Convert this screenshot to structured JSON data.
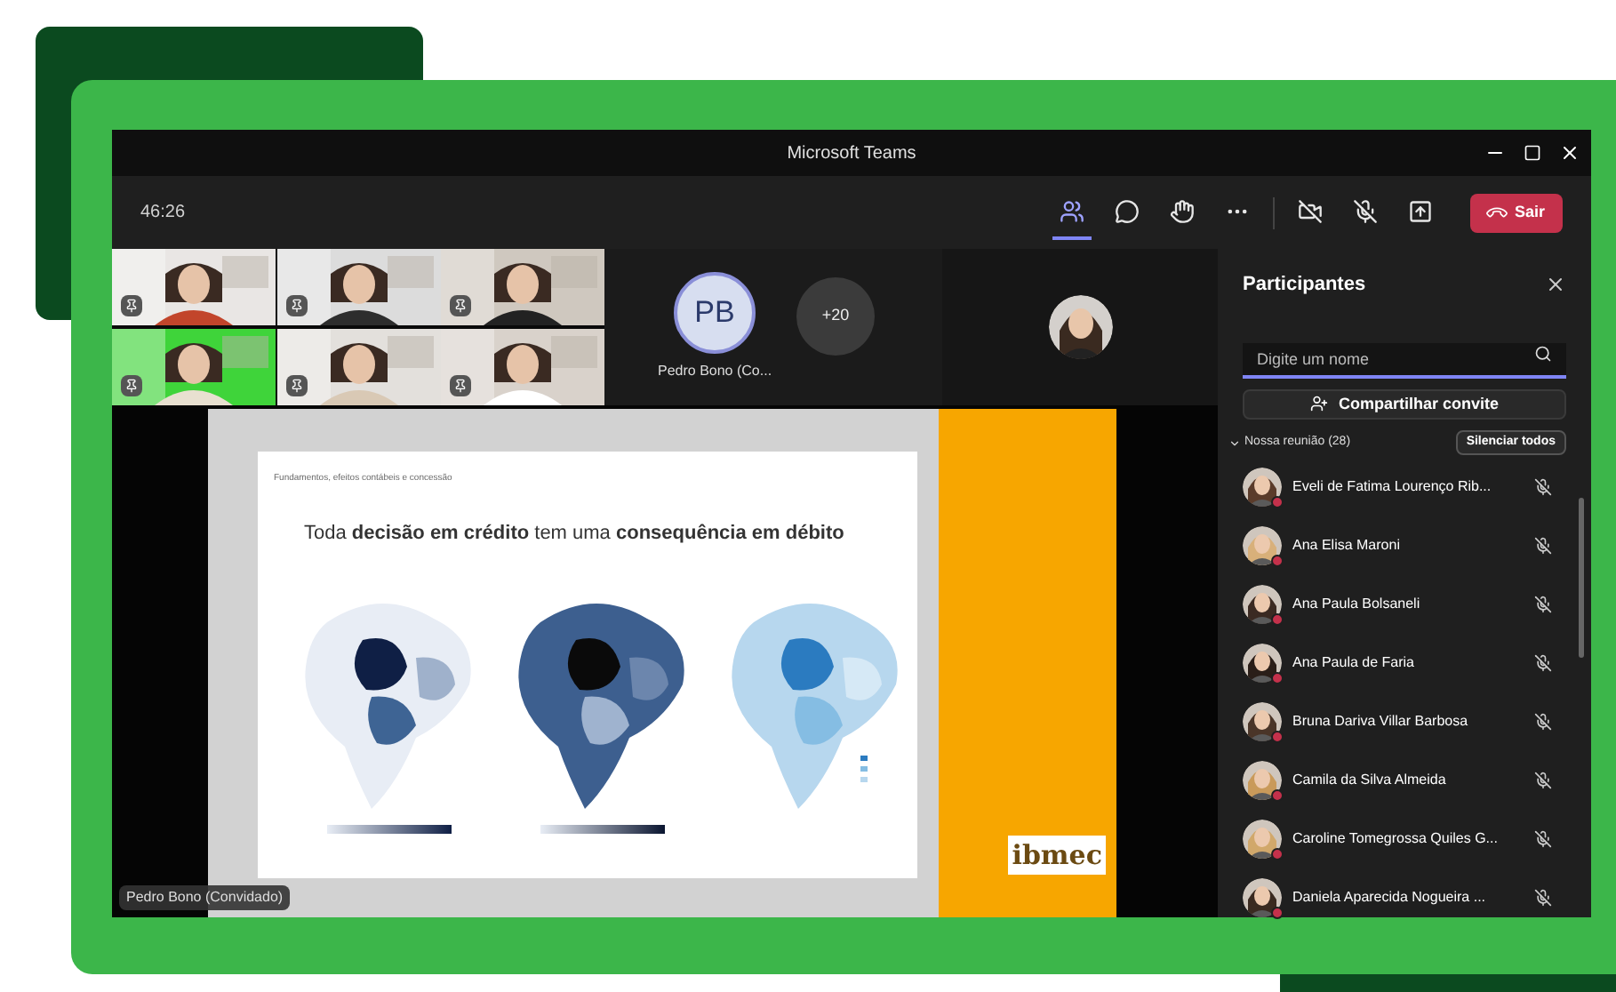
{
  "window": {
    "title": "Microsoft Teams"
  },
  "toolbar": {
    "timer": "46:26",
    "buttons": [
      {
        "kind": "people",
        "selected": true
      },
      {
        "kind": "chat",
        "selected": false
      },
      {
        "kind": "reactions",
        "selected": false
      },
      {
        "kind": "more",
        "selected": false
      },
      {
        "kind": "camera",
        "selected": false
      },
      {
        "kind": "mic",
        "selected": false
      },
      {
        "kind": "share",
        "selected": false
      }
    ],
    "leave_button": "Sair"
  },
  "avatar_tile": {
    "initials": "PB",
    "name": "Pedro Bono (Co..."
  },
  "overflow": {
    "label": "+20"
  },
  "stage": {
    "slide": {
      "breadcrumb": "Fundamentos, efeitos contábeis e concessão",
      "title": "Toda **decisão em crédito** tem uma **consequência em débito**",
      "logo": "ibmec"
    },
    "presenter": "Pedro Bono (Convidado)"
  },
  "participants_panel": {
    "title": "Participantes",
    "search": {
      "placeholder": "Digite um nome"
    },
    "invite_button": "Compartilhar convite",
    "section": {
      "label": "Nossa reunião (28)",
      "expanded": true
    },
    "mute_all_button": "Silenciar todos",
    "people": [
      {
        "name": "Eveli de Fatima Lourenço Rib...",
        "muted": true
      },
      {
        "name": "Ana Elisa Maroni",
        "muted": true
      },
      {
        "name": "Ana Paula Bolsaneli",
        "muted": true
      },
      {
        "name": "Ana Paula de Faria",
        "muted": true
      },
      {
        "name": "Bruna Dariva Villar Barbosa",
        "muted": true
      },
      {
        "name": "Camila da Silva Almeida",
        "muted": true
      },
      {
        "name": "Caroline Tomegrossa Quiles G...",
        "muted": true
      },
      {
        "name": "Daniela Aparecida Nogueira ...",
        "muted": true
      }
    ]
  }
}
